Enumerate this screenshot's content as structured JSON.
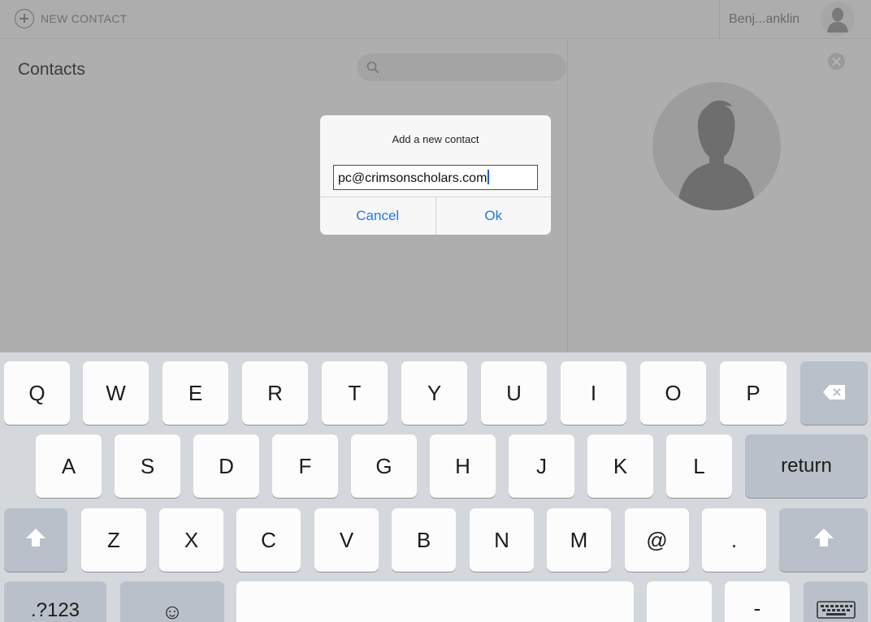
{
  "topbar": {
    "new_contact_label": "NEW CONTACT",
    "user_name": "Benj...anklin"
  },
  "contacts": {
    "title": "Contacts",
    "search_placeholder": ""
  },
  "dialog": {
    "title": "Add a new contact",
    "input_value": "pc@crimsonscholars.com",
    "cancel_label": "Cancel",
    "ok_label": "Ok"
  },
  "keyboard": {
    "row1": [
      "Q",
      "W",
      "E",
      "R",
      "T",
      "Y",
      "U",
      "I",
      "O",
      "P"
    ],
    "row2": [
      "A",
      "S",
      "D",
      "F",
      "G",
      "H",
      "J",
      "K",
      "L"
    ],
    "return_label": "return",
    "row3": [
      "Z",
      "X",
      "C",
      "V",
      "B",
      "N",
      "M",
      "@",
      "."
    ],
    "numbers_label": ".?123",
    "emoji_label": "☺",
    "dash_label": "-"
  },
  "colors": {
    "accent": "#1e7ad9",
    "overlay_gray": "#aeaeae",
    "keyboard_bg": "#d4d7dc"
  },
  "icons": {
    "new_contact": "plus-circle-icon",
    "user": "person-icon",
    "search": "magnifier-icon",
    "close": "close-circle-icon",
    "backspace": "backspace-icon",
    "shift": "shift-arrow-icon",
    "hide_keyboard": "keyboard-icon"
  }
}
